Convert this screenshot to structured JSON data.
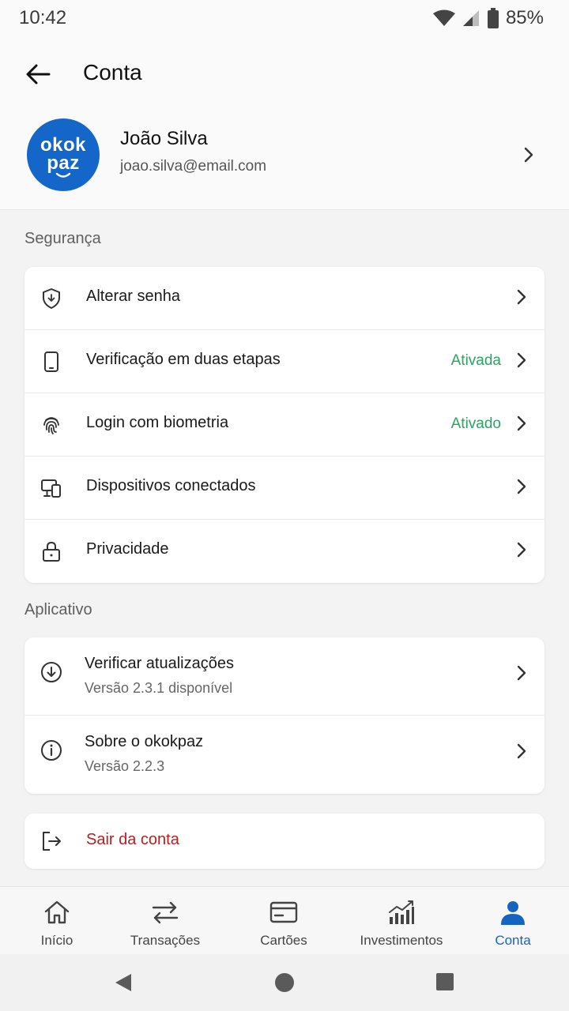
{
  "status_bar": {
    "time": "10:42",
    "battery": "85%"
  },
  "app_bar": {
    "title": "Conta"
  },
  "profile": {
    "avatar_line1": "okok",
    "avatar_line2": "paz",
    "name": "João Silva",
    "email": "joao.silva@email.com"
  },
  "security": {
    "label": "Segurança",
    "items": [
      {
        "label": "Alterar senha",
        "icon": "shield-icon",
        "status": ""
      },
      {
        "label": "Verificação em duas etapas",
        "icon": "phone-icon",
        "status": "Ativada"
      },
      {
        "label": "Login com biometria",
        "icon": "fingerprint-icon",
        "status": "Ativado"
      },
      {
        "label": "Dispositivos conectados",
        "icon": "devices-icon",
        "status": ""
      },
      {
        "label": "Privacidade",
        "icon": "lock-icon",
        "status": ""
      }
    ]
  },
  "app": {
    "label": "Aplicativo",
    "items": [
      {
        "label": "Verificar atualizações",
        "sub": "Versão 2.3.1 disponível",
        "icon": "download-icon"
      },
      {
        "label": "Sobre o okokpaz",
        "sub": "Versão 2.2.3",
        "icon": "info-icon"
      }
    ]
  },
  "logout": {
    "label": "Sair da conta"
  },
  "nav": {
    "items": [
      {
        "label": "Início",
        "icon": "home-icon"
      },
      {
        "label": "Transações",
        "icon": "transfer-icon"
      },
      {
        "label": "Cartões",
        "icon": "card-icon"
      },
      {
        "label": "Investimentos",
        "icon": "chart-icon"
      },
      {
        "label": "Conta",
        "icon": "person-icon",
        "active": true
      }
    ]
  },
  "colors": {
    "brand": "#1466c8",
    "accent": "#1565c0",
    "success": "#2aa561",
    "danger": "#b51f1f"
  }
}
